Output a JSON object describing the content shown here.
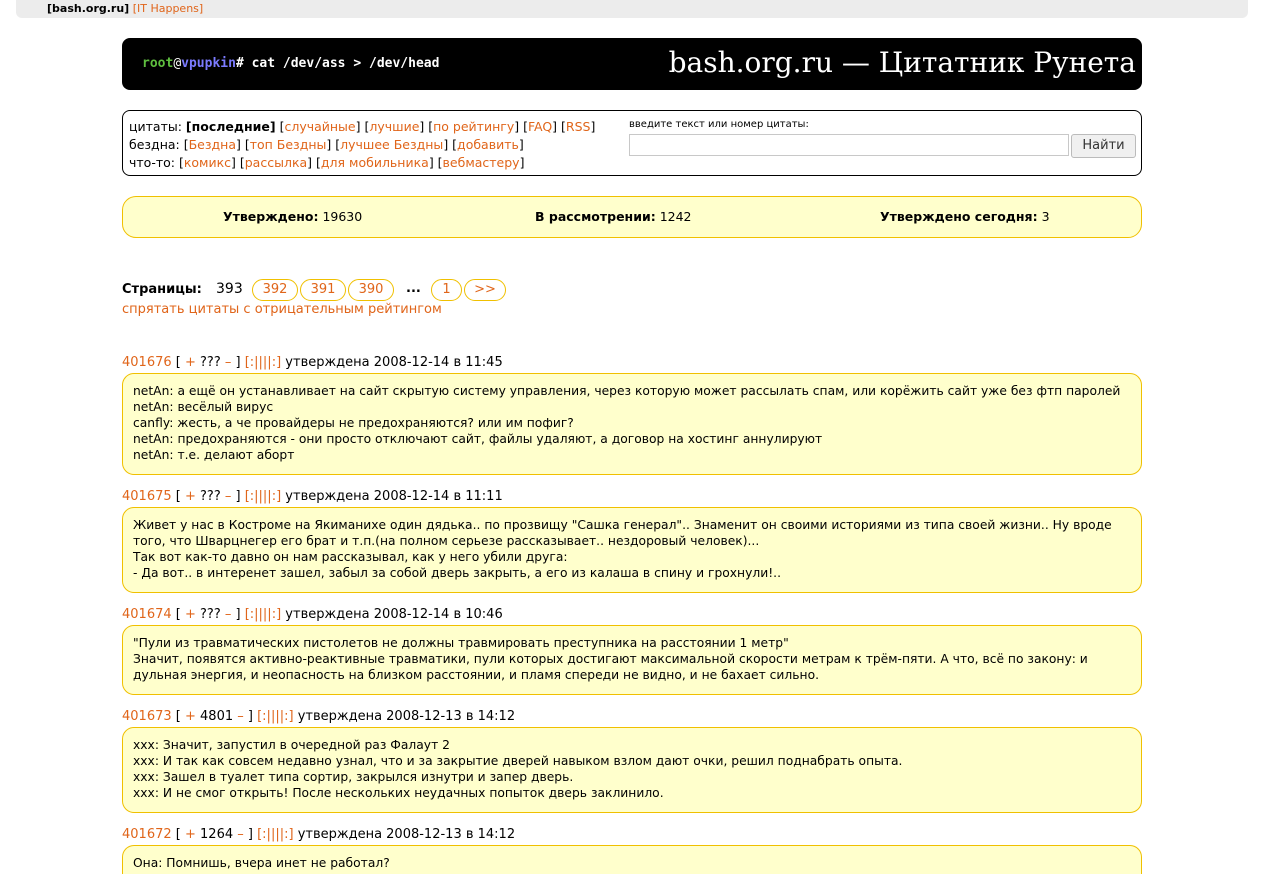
{
  "topbar": {
    "site": "[bash.org.ru]",
    "link": "[IT Happens]"
  },
  "header": {
    "prompt_user": "root",
    "prompt_at": "@",
    "prompt_host": "vpupkin",
    "prompt_cmd": "# cat /dev/ass > /dev/head",
    "title": "bash.org.ru — Цитатник Рунета"
  },
  "menu": {
    "row1_label": "цитаты:",
    "row1_current": "[последние]",
    "row1_items": [
      "случайные",
      "лучшие",
      "по рейтингу",
      "FAQ",
      "RSS"
    ],
    "row2_label": "бездна:",
    "row2_items": [
      "Бездна",
      "топ Бездны",
      "лучшее Бездны",
      "добавить"
    ],
    "row3_label": "что-то:",
    "row3_items": [
      "комикс",
      "рассылка",
      "для мобильника",
      "вебмастеру"
    ]
  },
  "search": {
    "label": "введите текст или номер цитаты:",
    "value": "",
    "button": "Найти"
  },
  "stats": {
    "approved_label": "Утверждено:",
    "approved": "19630",
    "review_label": "В рассмотрении:",
    "review": "1242",
    "today_label": "Утверждено сегодня:",
    "today": "3"
  },
  "pagination": {
    "label": "Страницы:",
    "current": "393",
    "pages": [
      "392",
      "391",
      "390"
    ],
    "dots": "...",
    "first": "1",
    "next": ">>"
  },
  "hide_negative": "спрятать цитаты с отрицательным рейтингом",
  "quotes": [
    {
      "id": "401676",
      "rating": "???",
      "date": "утверждена 2008-12-14 в 11:45",
      "lines": [
        "netAn: а ещё он устанавливает на сайт скрытую систему управления, через которую может рассылать спам, или корёжить сайт уже без фтп паролей",
        "netAn: весёлый вирус",
        "canfly: жесть, а че провайдеры не предохраняются? или им пофиг?",
        "netAn: предохраняются - они просто отключают сайт, файлы удаляют, а договор на хостинг аннулируют",
        "netAn: т.е. делают аборт"
      ]
    },
    {
      "id": "401675",
      "rating": "???",
      "date": "утверждена 2008-12-14 в 11:11",
      "lines": [
        "Живет у нас в Костроме на Якиманихе один дядька.. по прозвищу \"Сашка генерал\".. Знаменит он своими историями из типа своей жизни.. Ну вроде того, что Шварцнегер его брат и т.п.(на полном серьезе рассказывает.. нездоровый человек)...",
        "Так вот как-то давно он нам рассказывал, как у него убили друга:",
        "- Да вот.. в интеренет зашел, забыл за собой дверь закрыть, а его из калаша в спину и грохнули!.."
      ]
    },
    {
      "id": "401674",
      "rating": "???",
      "date": "утверждена 2008-12-14 в 10:46",
      "lines": [
        "\"Пули из травматических пистолетов не должны травмировать преступника на расстоянии 1 метр\"",
        "Значит, появятся активно-реактивные травматики, пули которых достигают максимальной скорости метрам к трём-пяти. А что, всё по закону: и дульная энергия, и неопасность на близком расстоянии, и пламя спереди не видно, и не бахает сильно."
      ]
    },
    {
      "id": "401673",
      "rating": "4801",
      "date": "утверждена 2008-12-13 в 14:12",
      "lines": [
        "xxx: Значит, запустил в очередной раз Фалаут 2",
        "xxx: И так как совсем недавно узнал, что и за закрытие дверей навыком взлом дают очки, решил поднабрать опыта.",
        "xxx: Зашел в туалет типа сортир, закрылся изнутри и запер дверь.",
        "xxx: И не смог открыть! После нескольких неудачных попыток дверь заклинило."
      ]
    },
    {
      "id": "401672",
      "rating": "1264",
      "date": "утверждена 2008-12-13 в 14:12",
      "lines": [
        "Она: Помнишь, вчера инет не работал?"
      ]
    }
  ],
  "quote_controls": {
    "plus": "+",
    "minus": "–",
    "bayan": "[:||||:]"
  }
}
